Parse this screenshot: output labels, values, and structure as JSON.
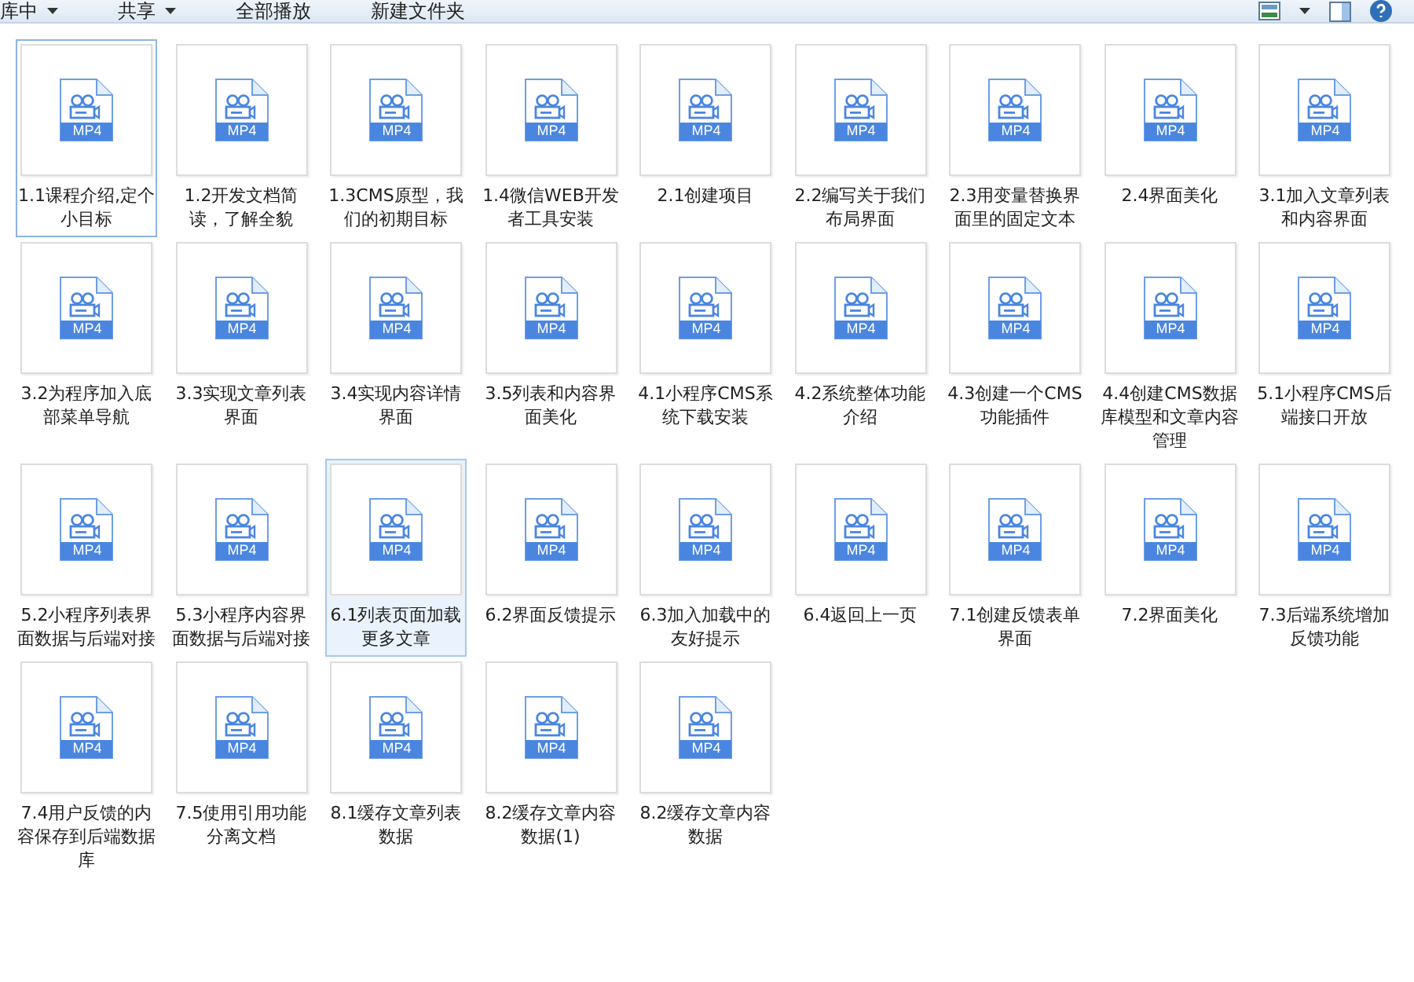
{
  "toolbar": {
    "items": [
      {
        "label": "库中",
        "dropdown": true
      },
      {
        "label": "共享",
        "dropdown": true
      },
      {
        "label": "全部播放",
        "dropdown": false
      },
      {
        "label": "新建文件夹",
        "dropdown": false
      }
    ]
  },
  "files": [
    {
      "name": "1.1课程介绍,定个小目标",
      "type": "MP4",
      "selected": false,
      "focused": true
    },
    {
      "name": "1.2开发文档简读，了解全貌",
      "type": "MP4",
      "selected": false,
      "focused": false
    },
    {
      "name": "1.3CMS原型，我们的初期目标",
      "type": "MP4",
      "selected": false,
      "focused": false
    },
    {
      "name": "1.4微信WEB开发者工具安装",
      "type": "MP4",
      "selected": false,
      "focused": false
    },
    {
      "name": "2.1创建项目",
      "type": "MP4",
      "selected": false,
      "focused": false
    },
    {
      "name": "2.2编写关于我们布局界面",
      "type": "MP4",
      "selected": false,
      "focused": false
    },
    {
      "name": "2.3用变量替换界面里的固定文本",
      "type": "MP4",
      "selected": false,
      "focused": false
    },
    {
      "name": "2.4界面美化",
      "type": "MP4",
      "selected": false,
      "focused": false
    },
    {
      "name": "3.1加入文章列表和内容界面",
      "type": "MP4",
      "selected": false,
      "focused": false
    },
    {
      "name": "3.2为程序加入底部菜单导航",
      "type": "MP4",
      "selected": false,
      "focused": false
    },
    {
      "name": "3.3实现文章列表界面",
      "type": "MP4",
      "selected": false,
      "focused": false
    },
    {
      "name": "3.4实现内容详情界面",
      "type": "MP4",
      "selected": false,
      "focused": false
    },
    {
      "name": "3.5列表和内容界面美化",
      "type": "MP4",
      "selected": false,
      "focused": false
    },
    {
      "name": "4.1小程序CMS系统下载安装",
      "type": "MP4",
      "selected": false,
      "focused": false
    },
    {
      "name": "4.2系统整体功能介绍",
      "type": "MP4",
      "selected": false,
      "focused": false
    },
    {
      "name": "4.3创建一个CMS功能插件",
      "type": "MP4",
      "selected": false,
      "focused": false
    },
    {
      "name": "4.4创建CMS数据库模型和文章内容管理",
      "type": "MP4",
      "selected": false,
      "focused": false
    },
    {
      "name": "5.1小程序CMS后端接口开放",
      "type": "MP4",
      "selected": false,
      "focused": false
    },
    {
      "name": "5.2小程序列表界面数据与后端对接",
      "type": "MP4",
      "selected": false,
      "focused": false
    },
    {
      "name": "5.3小程序内容界面数据与后端对接",
      "type": "MP4",
      "selected": false,
      "focused": false
    },
    {
      "name": "6.1列表页面加载更多文章",
      "type": "MP4",
      "selected": true,
      "focused": false
    },
    {
      "name": "6.2界面反馈提示",
      "type": "MP4",
      "selected": false,
      "focused": false
    },
    {
      "name": "6.3加入加载中的友好提示",
      "type": "MP4",
      "selected": false,
      "focused": false
    },
    {
      "name": "6.4返回上一页",
      "type": "MP4",
      "selected": false,
      "focused": false
    },
    {
      "name": "7.1创建反馈表单界面",
      "type": "MP4",
      "selected": false,
      "focused": false
    },
    {
      "name": "7.2界面美化",
      "type": "MP4",
      "selected": false,
      "focused": false
    },
    {
      "name": "7.3后端系统增加反馈功能",
      "type": "MP4",
      "selected": false,
      "focused": false
    },
    {
      "name": "7.4用户反馈的内容保存到后端数据库",
      "type": "MP4",
      "selected": false,
      "focused": false
    },
    {
      "name": "7.5使用引用功能分离文档",
      "type": "MP4",
      "selected": false,
      "focused": false
    },
    {
      "name": "8.1缓存文章列表数据",
      "type": "MP4",
      "selected": false,
      "focused": false
    },
    {
      "name": "8.2缓存文章内容数据(1)",
      "type": "MP4",
      "selected": false,
      "focused": false
    },
    {
      "name": "8.2缓存文章内容数据",
      "type": "MP4",
      "selected": false,
      "focused": false
    }
  ]
}
